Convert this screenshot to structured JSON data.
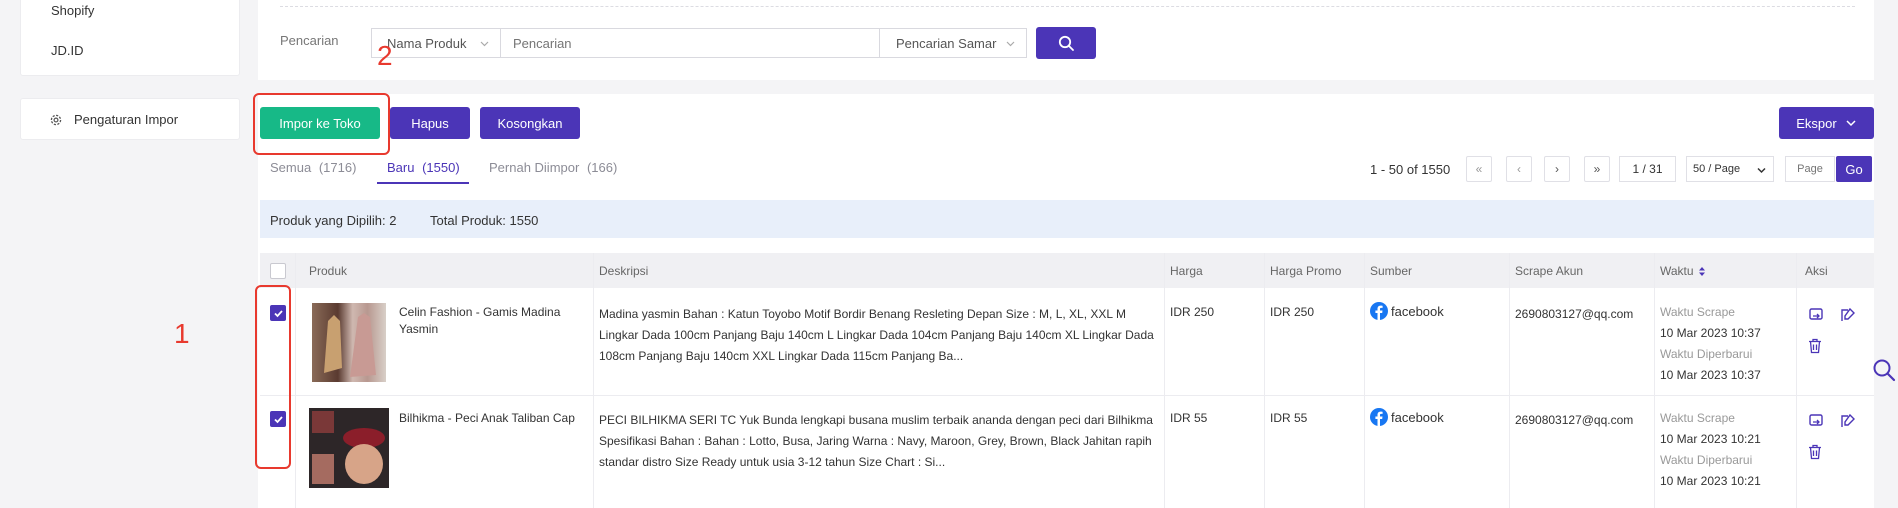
{
  "sidebar": {
    "items": [
      {
        "label": "Shopify"
      },
      {
        "label": "JD.ID"
      }
    ],
    "import_settings_label": "Pengaturan Impor"
  },
  "search": {
    "label": "Pencarian",
    "field_select": "Nama Produk",
    "placeholder": "Pencarian",
    "mode_select": "Pencarian Samar"
  },
  "actions": {
    "import_label": "Impor ke Toko",
    "delete_label": "Hapus",
    "clear_label": "Kosongkan",
    "export_label": "Ekspor"
  },
  "annotations": {
    "num1": "1",
    "num2": "2"
  },
  "tabs": [
    {
      "label": "Semua",
      "count": "(1716)"
    },
    {
      "label": "Baru",
      "count": "(1550)"
    },
    {
      "label": "Pernah Diimpor",
      "count": "(166)"
    }
  ],
  "pagination": {
    "range": "1 - 50 of 1550",
    "page_display": "1 / 31",
    "per_page": "50 / Page",
    "page_placeholder": "Page",
    "go_label": "Go"
  },
  "summary": {
    "selected": "Produk yang Dipilih: 2",
    "total": "Total Produk: 1550"
  },
  "table": {
    "headers": {
      "product": "Produk",
      "description": "Deskripsi",
      "price": "Harga",
      "promo": "Harga Promo",
      "source": "Sumber",
      "account": "Scrape Akun",
      "time": "Waktu",
      "action": "Aksi"
    },
    "rows": [
      {
        "name": "Celin Fashion - Gamis Madina Yasmin",
        "desc": "Madina yasmin Bahan : Katun Toyobo Motif Bordir Benang Resleting Depan Size : M, L, XL, XXL M Lingkar Dada 100cm Panjang Baju 140cm L Lingkar Dada 104cm Panjang Baju 140cm XL Lingkar Dada 108cm Panjang Baju 140cm XXL Lingkar Dada 115cm Panjang Ba...",
        "price": "IDR 250",
        "promo": "IDR 250",
        "source": "facebook",
        "account": "2690803127@qq.com",
        "scrape_label": "Waktu Scrape",
        "scrape_time": "10 Mar 2023 10:37",
        "update_label": "Waktu Diperbarui",
        "update_time": "10 Mar 2023 10:37"
      },
      {
        "name": "Bilhikma - Peci Anak Taliban Cap",
        "desc": "PECI BILHIKMA SERI TC Yuk Bunda lengkapi busana muslim terbaik ananda dengan peci dari Bilhikma Spesifikasi Bahan : Bahan : Lotto, Busa, Jaring Warna : Navy, Maroon, Grey, Brown, Black Jahitan rapih standar distro Size Ready untuk usia 3-12 tahun Size Chart : Si...",
        "price": "IDR 55",
        "promo": "IDR 55",
        "source": "facebook",
        "account": "2690803127@qq.com",
        "scrape_label": "Waktu Scrape",
        "scrape_time": "10 Mar 2023 10:21",
        "update_label": "Waktu Diperbarui",
        "update_time": "10 Mar 2023 10:21"
      }
    ]
  },
  "colors": {
    "primary": "#4b35b7",
    "success": "#17b987",
    "annotation": "#e8392e",
    "facebook": "#1877f2"
  }
}
